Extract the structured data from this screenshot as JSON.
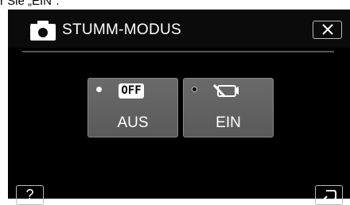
{
  "caption": "r Sie „EIN\".",
  "header": {
    "title": "STUMM-MODUS",
    "mode_icon": "camera-icon",
    "close_icon": "close-icon"
  },
  "options": [
    {
      "label": "AUS",
      "badge": "OFF",
      "selected": false,
      "icon": "off-badge"
    },
    {
      "label": "EIN",
      "badge": "",
      "selected": true,
      "icon": "silent-mode-icon"
    }
  ],
  "footer": {
    "help_label": "?",
    "back_icon": "return-icon"
  }
}
